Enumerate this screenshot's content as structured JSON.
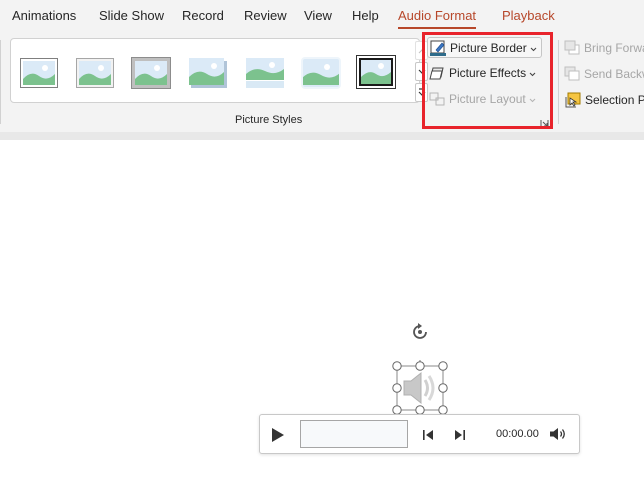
{
  "tabs": [
    {
      "label": "Animations"
    },
    {
      "label": "Slide Show"
    },
    {
      "label": "Record"
    },
    {
      "label": "Review"
    },
    {
      "label": "View"
    },
    {
      "label": "Help"
    },
    {
      "label": "Audio Format"
    },
    {
      "label": "Playback"
    }
  ],
  "picture_styles": {
    "group_label": "Picture Styles",
    "thumbnails": [
      {
        "icon": "picture-style-simple-frame-icon"
      },
      {
        "icon": "picture-style-beveled-icon"
      },
      {
        "icon": "picture-style-thick-frame-icon"
      },
      {
        "icon": "picture-style-shadow-icon"
      },
      {
        "icon": "picture-style-reflected-icon"
      },
      {
        "icon": "picture-style-soft-edge-icon"
      },
      {
        "icon": "picture-style-black-frame-icon"
      }
    ]
  },
  "picture_commands": {
    "border": "Picture Border",
    "effects": "Picture Effects",
    "layout": "Picture Layout"
  },
  "arrange": {
    "bring_forward": "Bring Forwa",
    "send_backward": "Send Backw",
    "selection_pane": "Selection P"
  },
  "player": {
    "time": "00:00.00"
  },
  "colors": {
    "accent": "#b7472a",
    "highlight": "#e8232b"
  }
}
